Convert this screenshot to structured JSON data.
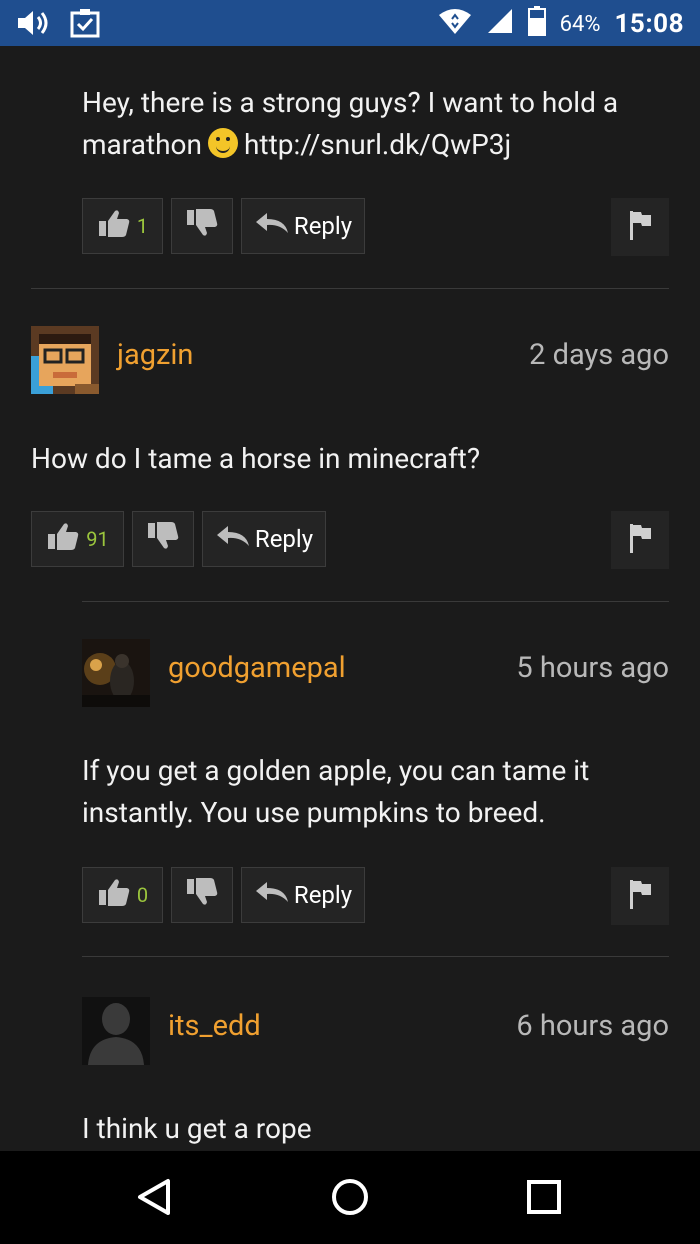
{
  "status_bar": {
    "battery": "64%",
    "time": "15:08"
  },
  "comments": [
    {
      "text_before_smiley": "Hey, there is a strong guys? I want to hold a marathon",
      "text_after_smiley": "http://snurl.dk/QwP3j",
      "likes": "1",
      "reply_label": "Reply"
    },
    {
      "username": "jagzin",
      "time": "2 days ago",
      "text": "How do I tame a horse in minecraft?",
      "likes": "91",
      "reply_label": "Reply"
    },
    {
      "username": "goodgamepal",
      "time": "5 hours ago",
      "text": "If you get a golden apple, you can tame it instantly. You use pumpkins to breed.",
      "likes": "0",
      "reply_label": "Reply"
    },
    {
      "username": "its_edd",
      "time": "6 hours ago",
      "text": "I think u get a rope"
    }
  ],
  "colors": {
    "username": "#f0a030",
    "like_count": "#9bc53d",
    "status_bar": "#1f4e8f"
  }
}
